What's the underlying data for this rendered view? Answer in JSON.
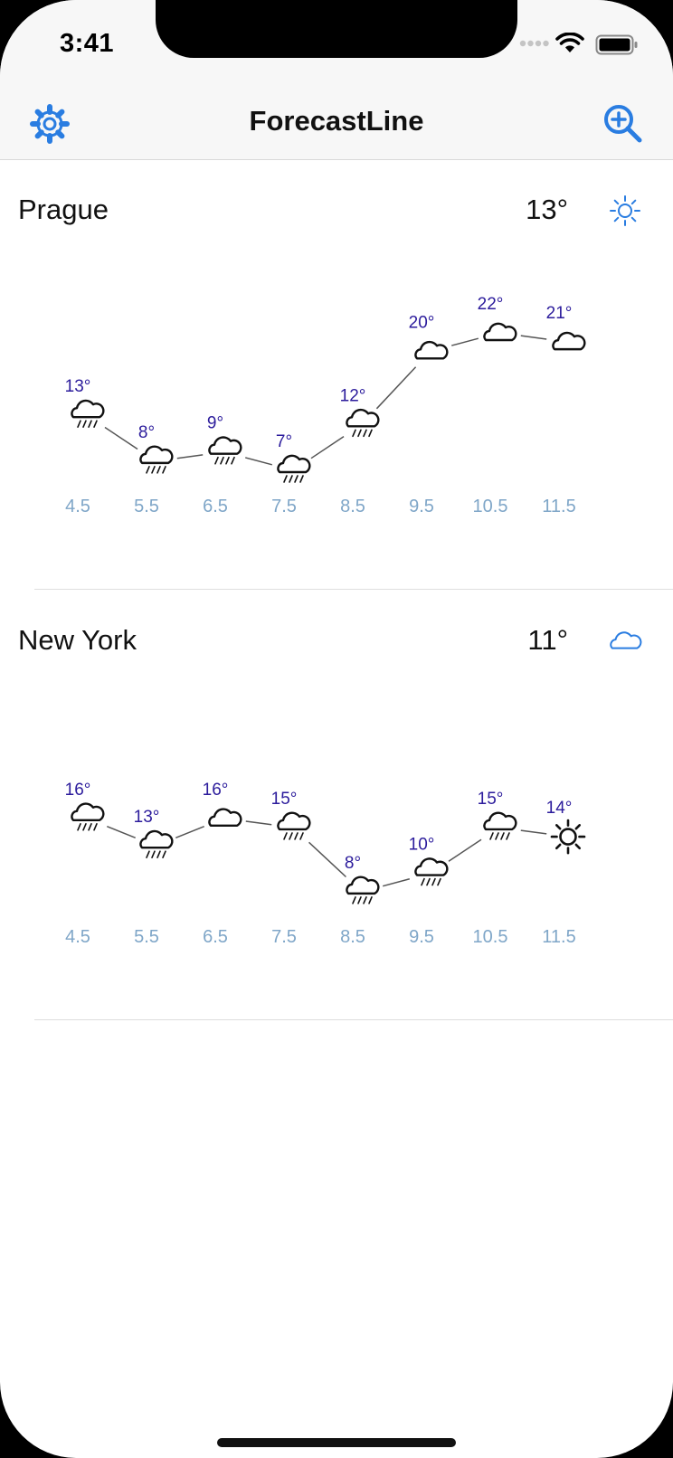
{
  "status": {
    "time": "3:41"
  },
  "navbar": {
    "title": "ForecastLine",
    "settings_icon": "gear-icon",
    "zoom_icon": "zoom-in-icon"
  },
  "colors": {
    "accent": "#2a7de1",
    "temp_label": "#2c1c9c",
    "date_label": "#7fa6c8",
    "line": "#555555"
  },
  "cities": [
    {
      "name": "Prague",
      "current_temp": "13°",
      "current_icon": "sun-icon",
      "forecast": [
        {
          "date": "4.5",
          "temp": 13,
          "icon": "rain"
        },
        {
          "date": "5.5",
          "temp": 8,
          "icon": "rain"
        },
        {
          "date": "6.5",
          "temp": 9,
          "icon": "rain"
        },
        {
          "date": "7.5",
          "temp": 7,
          "icon": "rain"
        },
        {
          "date": "8.5",
          "temp": 12,
          "icon": "rain"
        },
        {
          "date": "9.5",
          "temp": 20,
          "icon": "cloud"
        },
        {
          "date": "10.5",
          "temp": 22,
          "icon": "cloud"
        },
        {
          "date": "11.5",
          "temp": 21,
          "icon": "cloud"
        }
      ]
    },
    {
      "name": "New York",
      "current_temp": "11°",
      "current_icon": "cloud-icon",
      "forecast": [
        {
          "date": "4.5",
          "temp": 16,
          "icon": "rain"
        },
        {
          "date": "5.5",
          "temp": 13,
          "icon": "rain"
        },
        {
          "date": "6.5",
          "temp": 16,
          "icon": "cloud"
        },
        {
          "date": "7.5",
          "temp": 15,
          "icon": "rain"
        },
        {
          "date": "8.5",
          "temp": 8,
          "icon": "rain"
        },
        {
          "date": "9.5",
          "temp": 10,
          "icon": "rain"
        },
        {
          "date": "10.5",
          "temp": 15,
          "icon": "rain"
        },
        {
          "date": "11.5",
          "temp": 14,
          "icon": "sun"
        }
      ]
    }
  ]
}
